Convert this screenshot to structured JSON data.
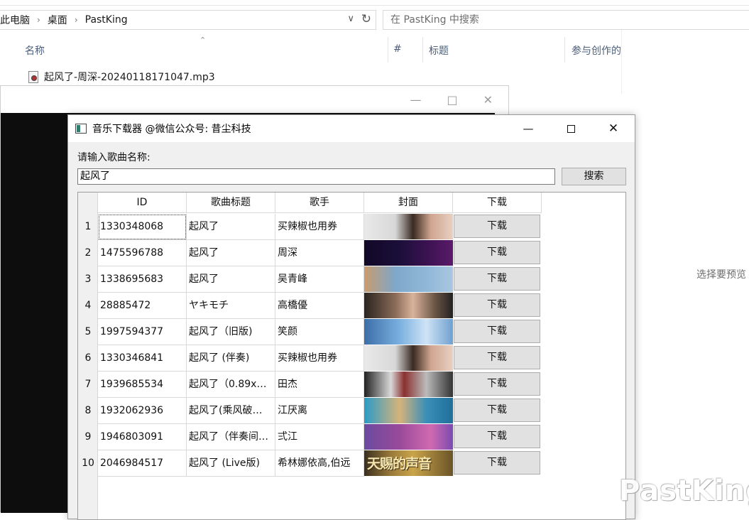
{
  "explorer": {
    "breadcrumb": [
      "此电脑",
      "桌面",
      "PastKing"
    ],
    "search_placeholder": "在 PastKing 中搜索",
    "columns": {
      "name": "名称",
      "number": "#",
      "title": "标题",
      "contributor": "参与创作的"
    },
    "file": "起风了-周深-20240118171047.mp3",
    "preview_hint": "选择要预览"
  },
  "app": {
    "title": "音乐下载器 @微信公众号: 昔尘科技",
    "prompt_label": "请输入歌曲名称:",
    "query": "起风了",
    "search_button": "搜索",
    "headers": [
      "ID",
      "歌曲标题",
      "歌手",
      "封面",
      "下载"
    ],
    "rows": [
      {
        "n": "1",
        "id": "1330348068",
        "title": "起风了",
        "artist": "买辣椒也用券",
        "cover": "face-light",
        "download": "下载"
      },
      {
        "n": "2",
        "id": "1475596788",
        "title": "起风了",
        "artist": "周深",
        "cover": "dark-neon",
        "download": "下载"
      },
      {
        "n": "3",
        "id": "1338695683",
        "title": "起风了",
        "artist": "吴青峰",
        "cover": "sky-kanji",
        "download": "下载"
      },
      {
        "n": "4",
        "id": "28885472",
        "title": "ヤキモチ",
        "artist": "高橋優",
        "cover": "glasses-face",
        "download": "下载"
      },
      {
        "n": "5",
        "id": "1997594377",
        "title": "起风了（旧版)",
        "artist": "笑颜",
        "cover": "blue-sky",
        "download": "下载"
      },
      {
        "n": "6",
        "id": "1330346841",
        "title": "起风了 (伴奏)",
        "artist": "买辣椒也用券",
        "cover": "face-light",
        "download": "下载"
      },
      {
        "n": "7",
        "id": "1939685534",
        "title": "起风了（0.89x…",
        "artist": "田杰",
        "cover": "stage",
        "download": "下载"
      },
      {
        "n": "8",
        "id": "1932062936",
        "title": "起风了(乘风破…",
        "artist": "江厌离",
        "cover": "anime-teal",
        "download": "下载"
      },
      {
        "n": "9",
        "id": "1946803091",
        "title": "起风了（伴奏间…",
        "artist": "弍江",
        "cover": "purple-pink",
        "download": "下载"
      },
      {
        "n": "10",
        "id": "2046984517",
        "title": "起风了 (Live版)",
        "artist": "希林娜依高,伯远",
        "cover": "gold-text",
        "download": "下载",
        "cover_text": "天赐的声音"
      }
    ]
  },
  "watermark": "PastKing",
  "colors": {
    "accent_dark": "#0d0d0d",
    "button_face": "#e1e1e1"
  }
}
